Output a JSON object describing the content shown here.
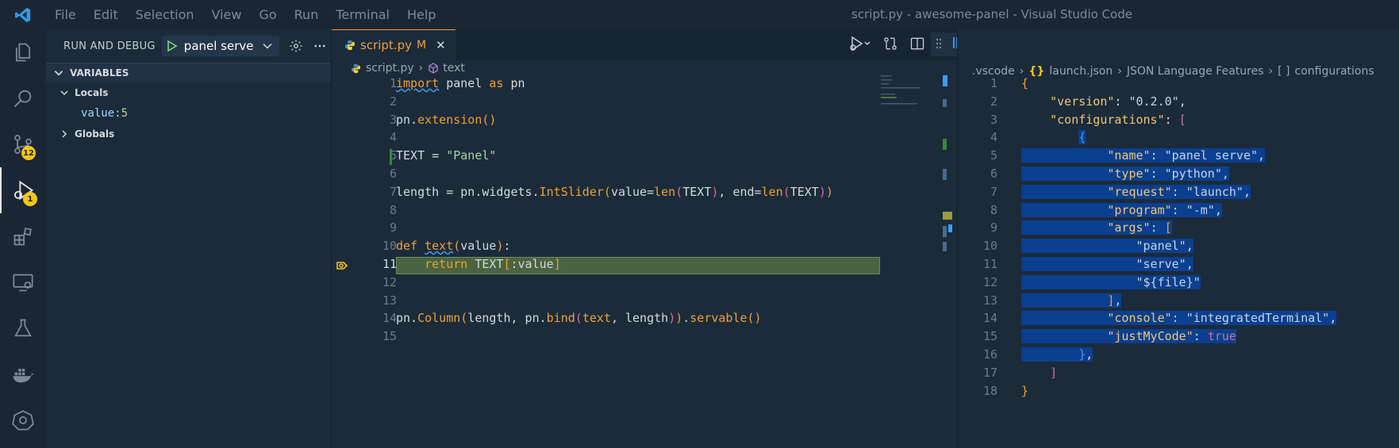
{
  "window": {
    "title": "script.py - awesome-panel - Visual Studio Code"
  },
  "menu": [
    "File",
    "Edit",
    "Selection",
    "View",
    "Go",
    "Run",
    "Terminal",
    "Help"
  ],
  "activity": {
    "scm_badge": "12",
    "debug_badge": "1"
  },
  "sidebar": {
    "title": "RUN AND DEBUG",
    "config": "panel serve",
    "section": "VARIABLES",
    "locals_label": "Locals",
    "var_name": "value",
    "var_value": "5",
    "globals_label": "Globals"
  },
  "editor": {
    "tab_name": "script.py",
    "tab_modified": "M",
    "breadcrumb_file": "script.py",
    "breadcrumb_symbol": "text",
    "current_line": 11
  },
  "json_editor": {
    "breadcrumb": [
      ".vscode",
      "launch.json",
      "JSON Language Features",
      "configurations"
    ]
  }
}
